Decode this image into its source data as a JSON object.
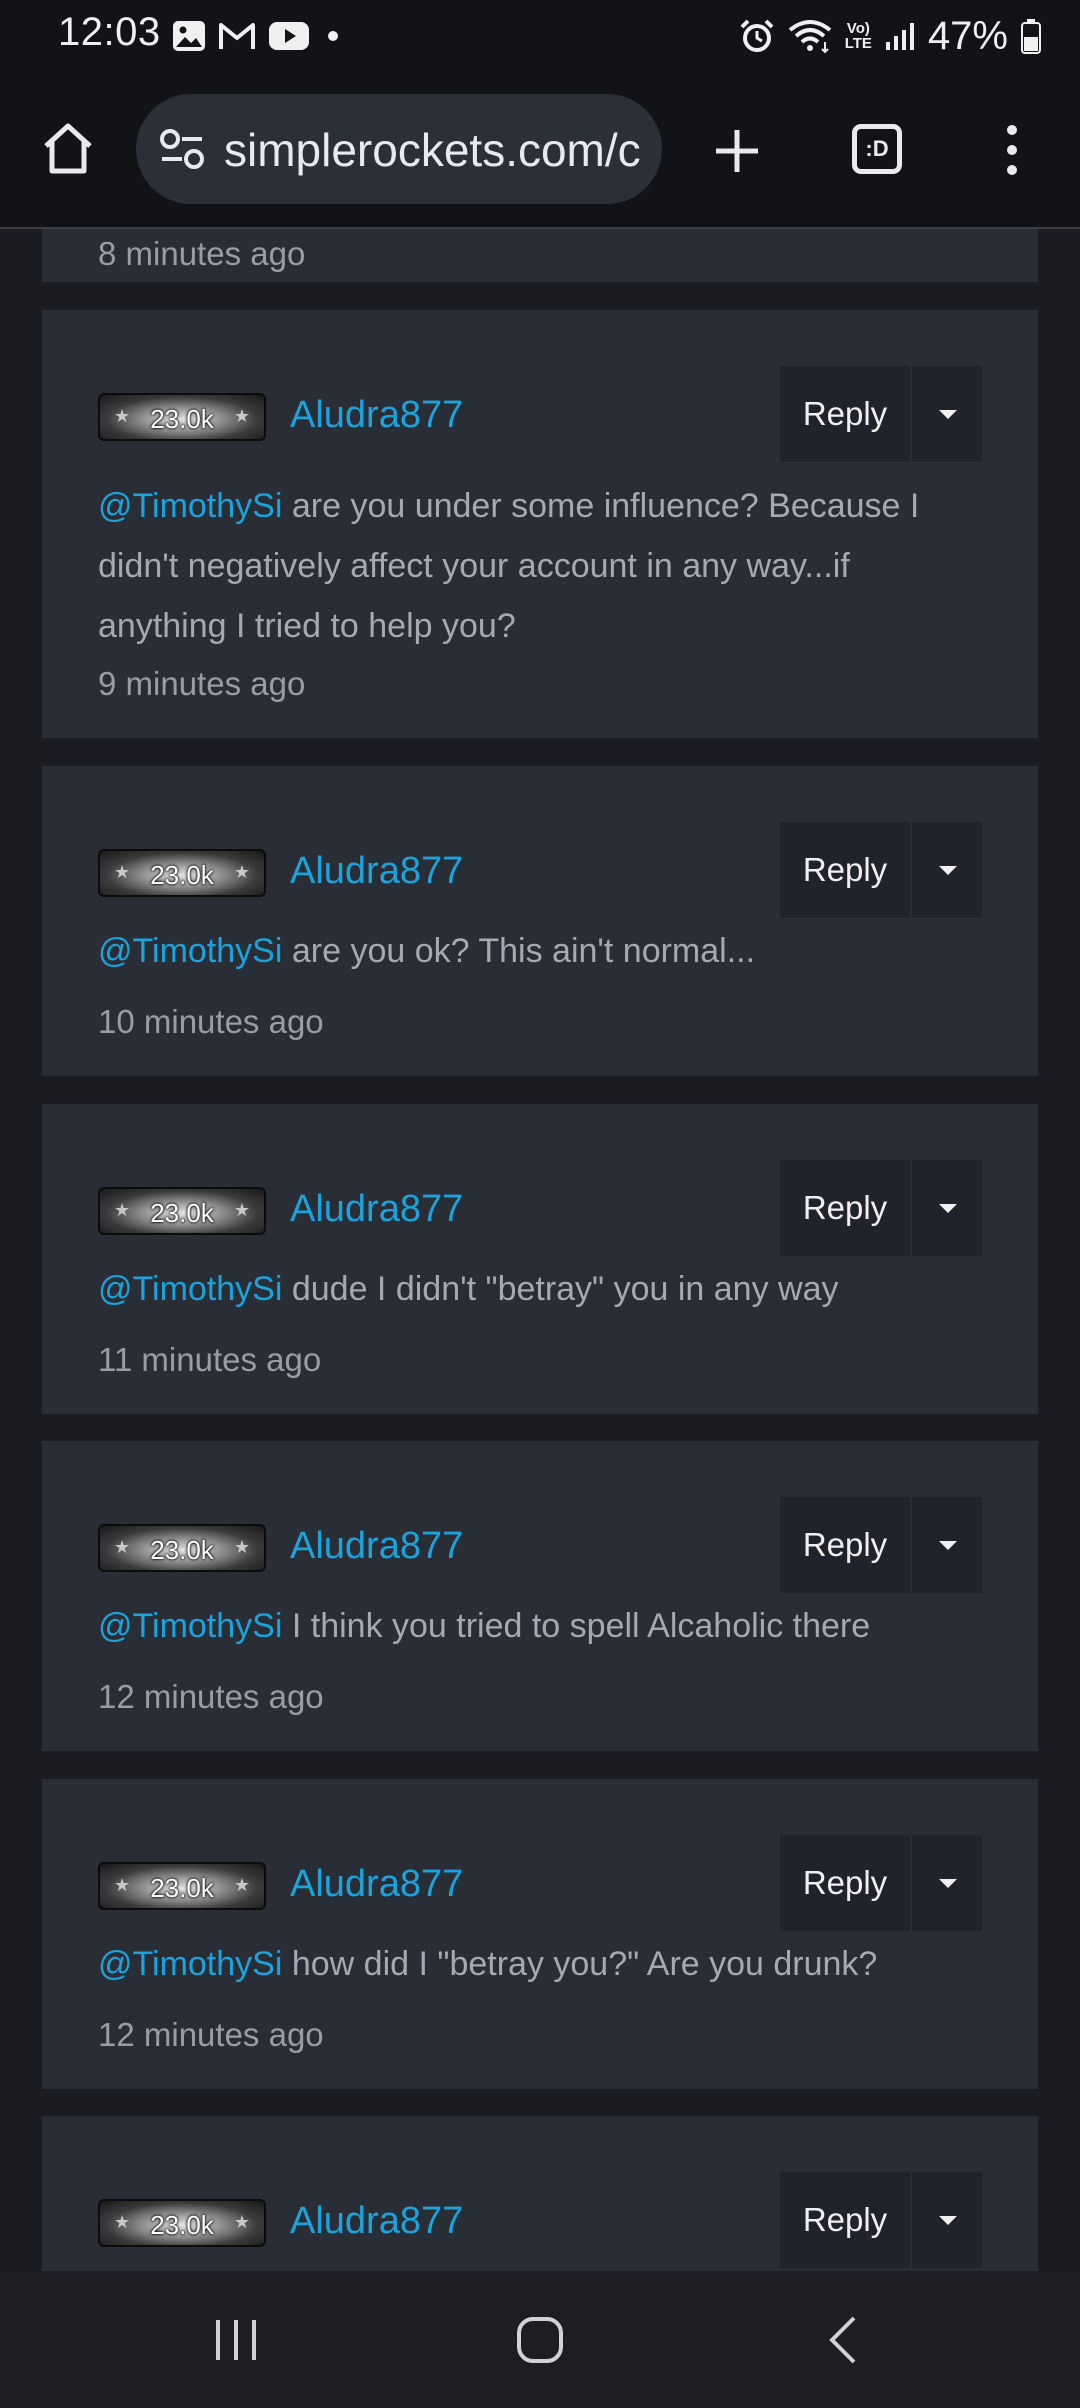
{
  "status_bar": {
    "time": "12:03",
    "battery": "47%",
    "icons_left": [
      "gallery-icon",
      "gmail-icon",
      "youtube-icon",
      "dot-icon"
    ],
    "icons_right": [
      "alarm-icon",
      "wifi-icon",
      "volte-icon",
      "signal-icon",
      "battery-icon"
    ],
    "volte_label_top": "Vo)",
    "volte_label_bottom": "LTE"
  },
  "browser": {
    "url": "simplerockets.com/c",
    "tab_label": ":D"
  },
  "partial_top_comment": {
    "timestamp": "8 minutes ago"
  },
  "comments": [
    {
      "badge": "23.0k",
      "username": "Aludra877",
      "reply_label": "Reply",
      "mention": "@TimothySi",
      "text": " are you under some influence? Because I didn't negatively affect your account in any way...if anything I tried to help you?",
      "timestamp": "9 minutes ago"
    },
    {
      "badge": "23.0k",
      "username": "Aludra877",
      "reply_label": "Reply",
      "mention": "@TimothySi",
      "text": " are you ok? This ain't normal...",
      "timestamp": "10 minutes ago"
    },
    {
      "badge": "23.0k",
      "username": "Aludra877",
      "reply_label": "Reply",
      "mention": "@TimothySi",
      "text": " dude I didn't \"betray\" you in any way",
      "timestamp": "11 minutes ago"
    },
    {
      "badge": "23.0k",
      "username": "Aludra877",
      "reply_label": "Reply",
      "mention": "@TimothySi",
      "text": " I think you tried to spell Alcaholic there",
      "timestamp": "12 minutes ago"
    },
    {
      "badge": "23.0k",
      "username": "Aludra877",
      "reply_label": "Reply",
      "mention": "@TimothySi",
      "text": " how did I \"betray you?\" Are you drunk?",
      "timestamp": "12 minutes ago"
    },
    {
      "badge": "23.0k",
      "username": "Aludra877",
      "reply_label": "Reply"
    }
  ],
  "nav": {
    "buttons": [
      "recent-apps-button",
      "home-button",
      "back-button"
    ]
  }
}
